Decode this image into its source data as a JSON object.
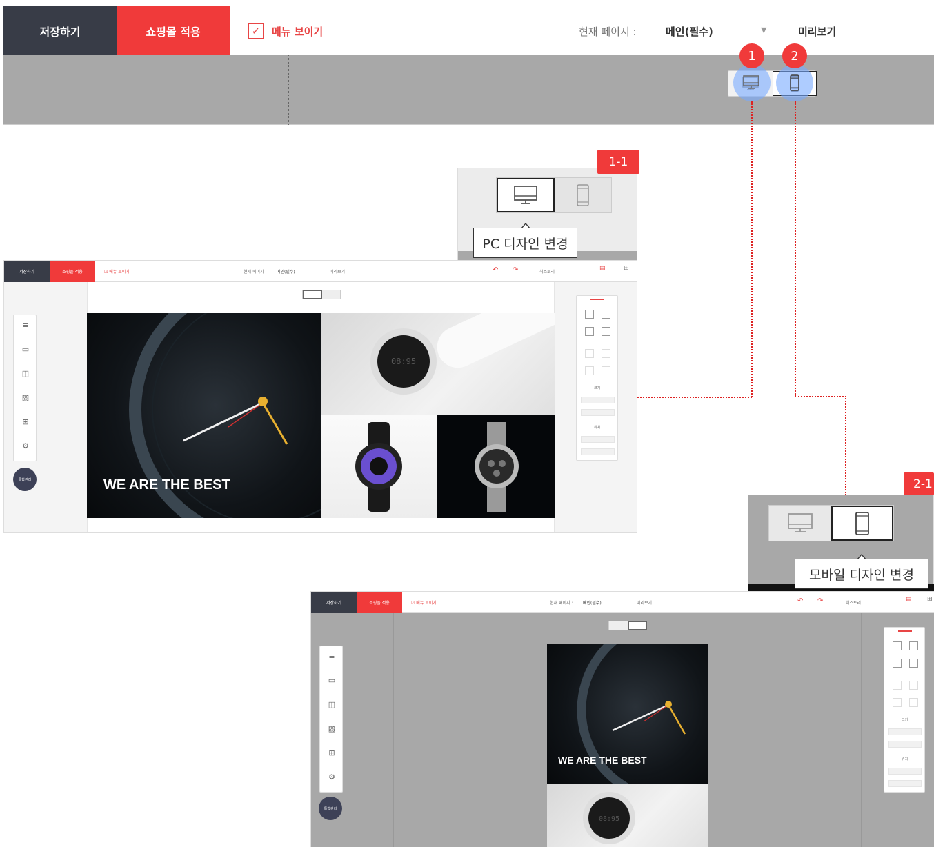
{
  "toolbar": {
    "save_label": "저장하기",
    "apply_label": "쇼핑몰 적용",
    "menu_show_label": "메뉴 보이기",
    "menu_show_checked": true,
    "current_page_label": "현재 페이지 :",
    "current_page_value": "메인(필수)",
    "preview_label": "미리보기"
  },
  "markers": {
    "m1": "1",
    "m2": "2",
    "m1_1": "1-1",
    "m2_1": "2-1"
  },
  "tooltips": {
    "pc": "PC 디자인 변경",
    "mobile": "모바일 디자인 변경"
  },
  "mini": {
    "save": "저장하기",
    "apply": "쇼핑몰 적용",
    "menu": "메뉴 보이기",
    "page_label": "현재 페이지 :",
    "page_value": "메인(필수)",
    "preview": "미리보기",
    "history": "히스토리",
    "profile": "통합관리",
    "hero": "WE ARE THE BEST",
    "size_label": "크기",
    "pos_label": "위치"
  },
  "colors": {
    "accent": "#f03a3a",
    "dark": "#383c47",
    "highlight": "#7aaaff"
  },
  "icons": [
    "desktop-icon",
    "mobile-icon",
    "check-icon",
    "caret-down-icon",
    "hamburger-icon",
    "panel-icon",
    "columns-icon",
    "image-icon",
    "grid-icon",
    "gear-icon",
    "undo-icon",
    "redo-icon"
  ]
}
